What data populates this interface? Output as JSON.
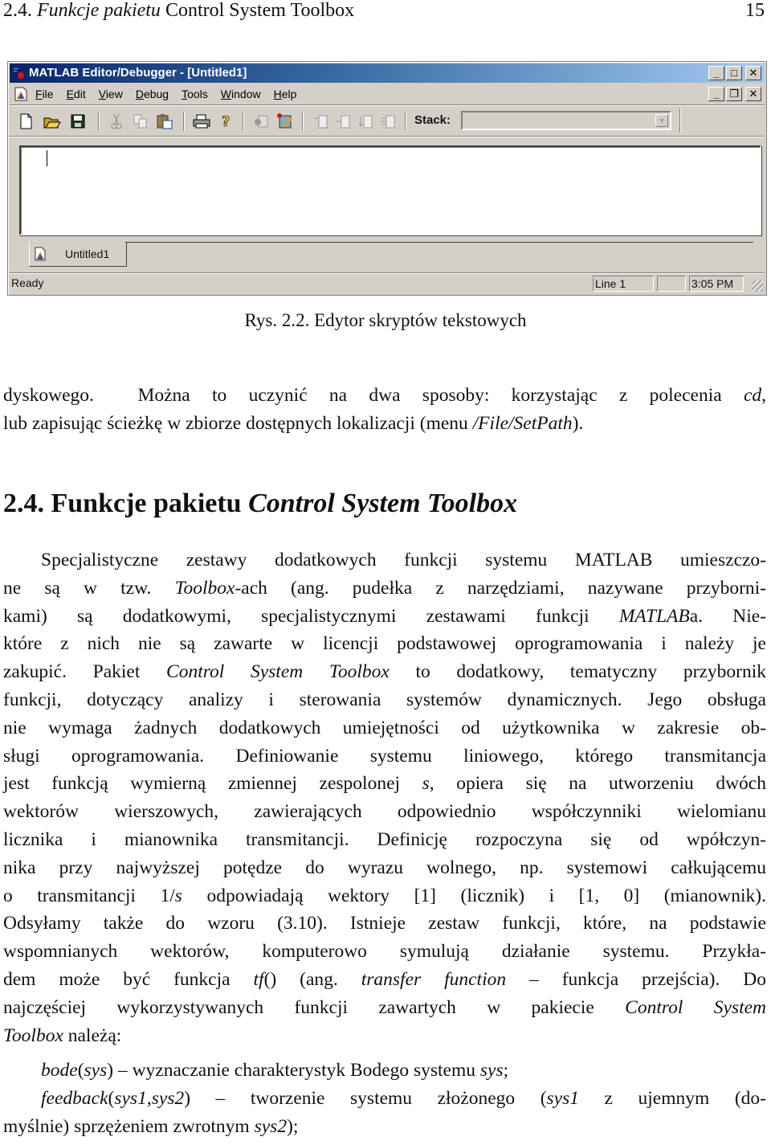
{
  "running_header": {
    "section": "2.4.",
    "title_italic": "Funkcje pakietu",
    "title_rest": "Control System Toolbox",
    "page_number": "15"
  },
  "figure": {
    "window": {
      "title": "MATLAB Editor/Debugger - [Untitled1]",
      "caption_buttons": [
        "minimize",
        "maximize",
        "close"
      ],
      "mdi_buttons": [
        "minimize",
        "restore",
        "close"
      ],
      "menu": [
        {
          "label": "File",
          "accel": "F"
        },
        {
          "label": "Edit",
          "accel": "E"
        },
        {
          "label": "View",
          "accel": "V"
        },
        {
          "label": "Debug",
          "accel": "D"
        },
        {
          "label": "Tools",
          "accel": "T"
        },
        {
          "label": "Window",
          "accel": "W"
        },
        {
          "label": "Help",
          "accel": "H"
        }
      ],
      "toolbar": {
        "buttons": [
          "new-file-icon",
          "open-folder-icon",
          "save-icon",
          "cut-icon",
          "copy-icon",
          "paste-icon",
          "print-icon",
          "help-icon",
          "set-breakpoint-icon",
          "clear-breakpoints-icon",
          "step-icon",
          "step-in-icon",
          "step-out-icon",
          "continue-icon"
        ],
        "stack_label": "Stack:",
        "stack_value": ""
      },
      "editor_content": "",
      "document_tab": "Untitled1",
      "status": {
        "message": "Ready",
        "line": "Line 1",
        "empty_panel": "",
        "time": "3:05 PM"
      }
    },
    "caption": "Rys. 2.2. Edytor skryptów tekstowych"
  },
  "intro_paragraph": [
    [
      {
        "t": "dyskowego.  Można to uczynić na dwa sposoby: korzystając z polecenia "
      },
      {
        "t": "cd",
        "i": true
      },
      {
        "t": ","
      }
    ],
    [
      {
        "t": "lub zapisując ścieżkę w zbiorze dostępnych lokalizacji (menu "
      },
      {
        "t": "/File/SetPath",
        "i": true
      },
      {
        "t": ")."
      }
    ]
  ],
  "section_heading": {
    "number": "2.4.",
    "text": "Funkcje pakietu",
    "italic": "Control System Toolbox"
  },
  "body_paragraph": [
    [
      {
        "t": "    Specjalistyczne zestawy dodatkowych funkcji systemu MATLAB umieszczo-"
      }
    ],
    [
      {
        "t": "ne są w tzw. "
      },
      {
        "t": "Toolbox",
        "i": true
      },
      {
        "t": "-ach (ang. pudełka z narzędziami, nazywane przyborni-"
      }
    ],
    [
      {
        "t": "kami) są dodatkowymi, specjalistycznymi zestawami funkcji "
      },
      {
        "t": "MATLAB",
        "i": true
      },
      {
        "t": "a. Nie-"
      }
    ],
    [
      {
        "t": "które z nich nie są zawarte w licencji podstawowej oprogramowania i należy je"
      }
    ],
    [
      {
        "t": "zakupić. Pakiet "
      },
      {
        "t": "Control System Toolbox",
        "i": true
      },
      {
        "t": " to dodatkowy, tematyczny przybornik"
      }
    ],
    [
      {
        "t": "funkcji, dotyczący analizy i sterowania systemów dynamicznych. Jego obsługa"
      }
    ],
    [
      {
        "t": "nie wymaga żadnych dodatkowych umiejętności od użytkownika w zakresie ob-"
      }
    ],
    [
      {
        "t": "sługi oprogramowania. Definiowanie systemu liniowego, którego transmitancja"
      }
    ],
    [
      {
        "t": "jest funkcją wymierną zmiennej zespolonej "
      },
      {
        "t": "s",
        "i": true
      },
      {
        "t": ", opiera się na utworzeniu dwóch"
      }
    ],
    [
      {
        "t": "wektorów wierszowych, zawierających odpowiednio współczynniki wielomianu"
      }
    ],
    [
      {
        "t": "licznika i mianownika transmitancji. Definicję rozpoczyna się od wpółczyn-"
      }
    ],
    [
      {
        "t": "nika przy najwyższej potędze do wyrazu wolnego, np. systemowi całkującemu"
      }
    ],
    [
      {
        "t": "o transmitancji 1/"
      },
      {
        "t": "s",
        "i": true
      },
      {
        "t": " odpowiadają wektory [1] (licznik) i [1, 0] (mianownik)."
      }
    ],
    [
      {
        "t": "Odsyłamy także do wzoru (3.10). Istnieje zestaw funkcji, które, na podstawie"
      }
    ],
    [
      {
        "t": "wspomnianych wektorów, komputerowo symulują działanie systemu. Przykła-"
      }
    ],
    [
      {
        "t": "dem może być funkcja "
      },
      {
        "t": "tf",
        "i": true
      },
      {
        "t": "() (ang. "
      },
      {
        "t": "transfer function",
        "i": true
      },
      {
        "t": " – funkcja przejścia). Do"
      }
    ],
    [
      {
        "t": "najczęściej wykorzystywanych funkcji zawartych w pakiecie "
      },
      {
        "t": "Control System",
        "i": true
      }
    ],
    [
      {
        "t": "Toolbox",
        "i": true
      },
      {
        "t": " należą:"
      }
    ]
  ],
  "function_list": [
    [
      [
        {
          "t": "    "
        },
        {
          "t": "bode",
          "i": true
        },
        {
          "t": "("
        },
        {
          "t": "sys",
          "i": true
        },
        {
          "t": ") – wyznaczanie charakterystyk Bodego systemu "
        },
        {
          "t": "sys",
          "i": true
        },
        {
          "t": ";"
        }
      ]
    ],
    [
      [
        {
          "t": "    "
        },
        {
          "t": "feedback",
          "i": true
        },
        {
          "t": "("
        },
        {
          "t": "sys1",
          "i": true
        },
        {
          "t": ","
        },
        {
          "t": "sys2",
          "i": true
        },
        {
          "t": ") – tworzenie systemu złożonego ("
        },
        {
          "t": "sys1",
          "i": true
        },
        {
          "t": " z ujemnym (do-"
        }
      ],
      [
        {
          "t": "myślnie) sprzężeniem zwrotnym "
        },
        {
          "t": "sys2",
          "i": true
        },
        {
          "t": ");"
        }
      ]
    ]
  ]
}
